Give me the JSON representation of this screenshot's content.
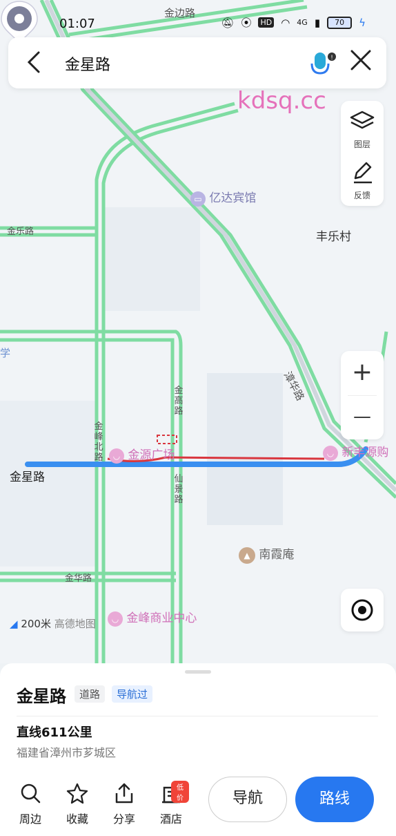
{
  "status_bar": {
    "time": "01:07",
    "hd": "HD",
    "network": "4G",
    "battery": "70"
  },
  "search": {
    "query": "金星路",
    "back_icon": "chevron-left-icon",
    "voice_icon": "voice-mic-icon",
    "close_icon": "close-icon"
  },
  "watermark": "kdsq.cc",
  "map_controls": {
    "layers_label": "图层",
    "feedback_label": "反馈",
    "zoom_in": "+",
    "zoom_out": "—"
  },
  "map_labels": {
    "road_jinbian": "金边路",
    "road_jinle": "金乐路",
    "road_jinhua": "金华路",
    "road_jingao": "金高路",
    "road_jinfengbei": "金峰北路",
    "road_xianjing": "仙景路",
    "road_zhanghua": "漳华路",
    "village_fengle": "丰乐村",
    "poi_yida": "亿达宾馆",
    "poi_jinyuan": "金源广场",
    "poi_xinfengyuan": "新丰源购",
    "poi_nanxia": "南霞庵",
    "poi_jinfeng": "金峰商业中心",
    "partial_left": "学",
    "pin_label": "金星路",
    "scale": "200米",
    "brand": "高德地图"
  },
  "colors": {
    "road": "#7fdca2",
    "highlight": "#3a8ff0",
    "annotation": "#d9363e",
    "poi": "#d070b8",
    "primary": "#2778f0"
  },
  "place": {
    "name": "金星路",
    "tag_type": "道路",
    "tag_nav": "导航过",
    "distance": "直线611公里",
    "address": "福建省漳州市芗城区"
  },
  "actions": {
    "nearby": "周边",
    "favorite": "收藏",
    "share": "分享",
    "hotel": "酒店",
    "hotel_badge": "低价",
    "navigate": "导航",
    "route": "路线"
  }
}
